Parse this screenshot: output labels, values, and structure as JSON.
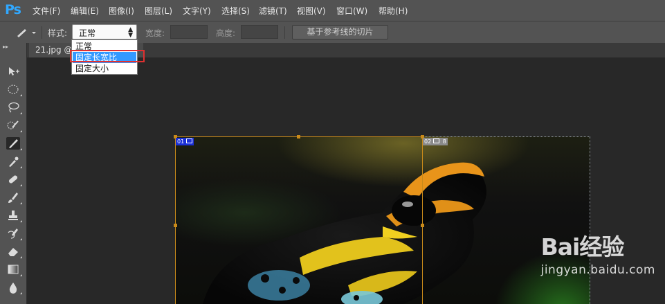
{
  "app": {
    "logo": "Ps",
    "accent": "#31a8ff"
  },
  "menu": [
    "文件(F)",
    "编辑(E)",
    "图像(I)",
    "图层(L)",
    "文字(Y)",
    "选择(S)",
    "滤镜(T)",
    "视图(V)",
    "窗口(W)",
    "帮助(H)"
  ],
  "options": {
    "style_label": "样式:",
    "style_value": "正常",
    "width_label": "宽度:",
    "height_label": "高度:",
    "slices_button": "基于参考线的切片"
  },
  "dropdown": {
    "options": [
      "正常",
      "固定长宽比",
      "固定大小"
    ],
    "selected_index": 1,
    "highlight_color": "#e03030"
  },
  "document": {
    "tab_title": "21.jpg @"
  },
  "slices": [
    {
      "number": "01",
      "selected": true
    },
    {
      "number": "02",
      "selected": false,
      "extra": "8"
    }
  ],
  "tools": [
    "move-tool-icon",
    "marquee-tool-icon",
    "lasso-tool-icon",
    "quick-selection-icon",
    "slice-tool-icon",
    "eyedropper-icon",
    "healing-brush-icon",
    "brush-icon",
    "stamp-icon",
    "history-brush-icon",
    "eraser-icon",
    "gradient-icon",
    "blur-icon"
  ],
  "watermark": {
    "brand": "Bai经验",
    "url": "jingyan.baidu.com"
  }
}
